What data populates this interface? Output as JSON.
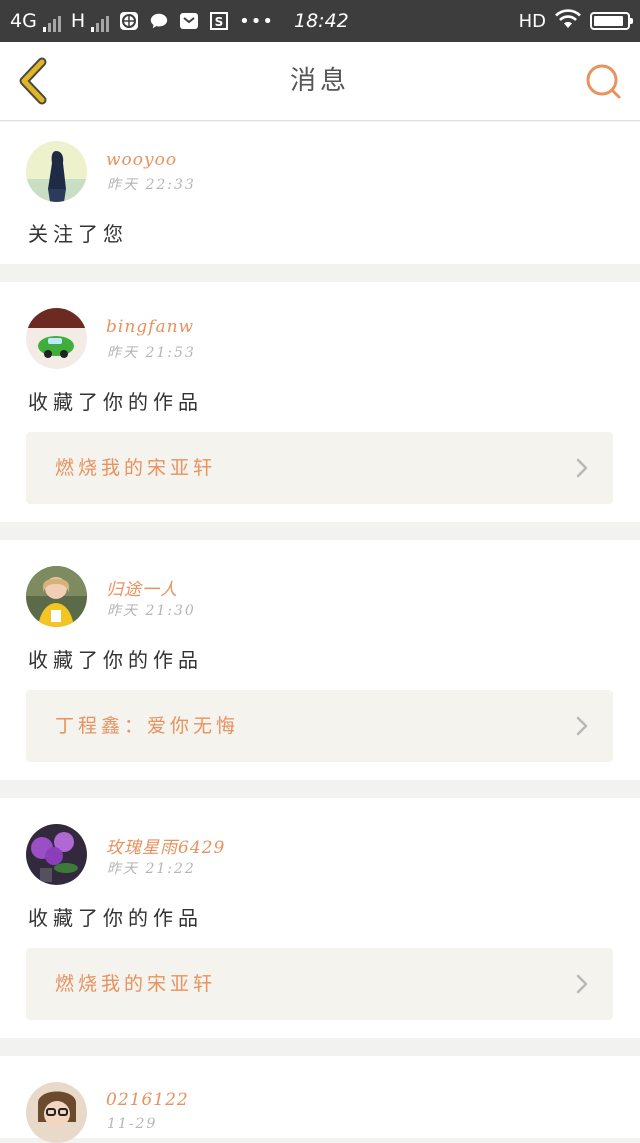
{
  "status_bar": {
    "network_1": "4G",
    "network_2": "H",
    "dots": "•••",
    "time": "18:42",
    "hd": "HD",
    "battery_level": 0.9
  },
  "nav": {
    "title": "消息",
    "accent_color": "#e8925f",
    "back_color": "#e0b52a"
  },
  "messages": [
    {
      "username": "wooyoo",
      "time": "昨天 22:33",
      "action": "关注了您"
    },
    {
      "username": "bingfanw",
      "time": "昨天 21:53",
      "action": "收藏了你的作品",
      "work_title": "燃烧我的宋亚轩"
    },
    {
      "username": "归途一人",
      "time": "昨天 21:30",
      "action": "收藏了你的作品",
      "work_title": "丁程鑫：爱你无悔"
    },
    {
      "username": "玫瑰星雨6429",
      "time": "昨天 21:22",
      "action": "收藏了你的作品",
      "work_title": "燃烧我的宋亚轩"
    },
    {
      "username": "0216122",
      "time": "11-29"
    }
  ]
}
